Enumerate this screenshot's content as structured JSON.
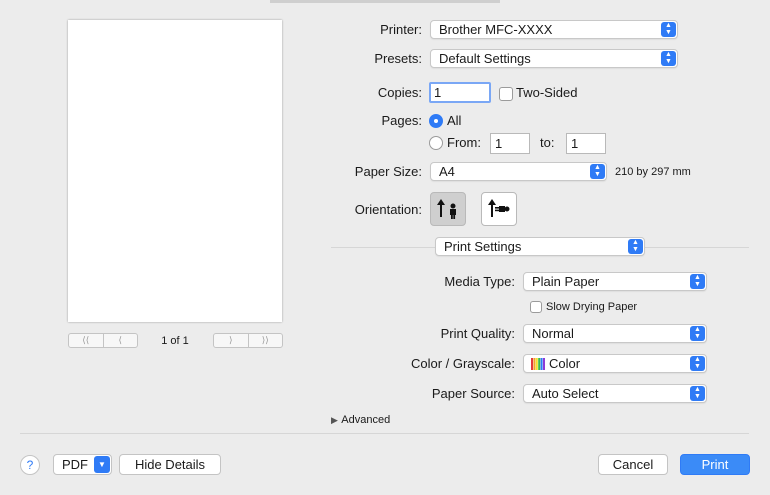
{
  "preview": {
    "page_label": "1 of 1"
  },
  "printer": {
    "label": "Printer:",
    "value": "Brother MFC-XXXX"
  },
  "presets": {
    "label": "Presets:",
    "value": "Default Settings"
  },
  "copies": {
    "label": "Copies:",
    "value": "1",
    "two_sided_label": "Two-Sided"
  },
  "pages": {
    "label": "Pages:",
    "all_label": "All",
    "from_label": "From:",
    "from_value": "1",
    "to_label": "to:",
    "to_value": "1"
  },
  "paper_size": {
    "label": "Paper Size:",
    "value": "A4",
    "dimensions": "210 by 297 mm"
  },
  "orientation": {
    "label": "Orientation:"
  },
  "section": {
    "value": "Print Settings"
  },
  "media_type": {
    "label": "Media Type:",
    "value": "Plain Paper",
    "slow_drying_label": "Slow Drying Paper"
  },
  "print_quality": {
    "label": "Print Quality:",
    "value": "Normal"
  },
  "color_grayscale": {
    "label": "Color / Grayscale:",
    "value": "Color"
  },
  "paper_source": {
    "label": "Paper Source:",
    "value": "Auto Select"
  },
  "advanced": {
    "label": "Advanced"
  },
  "footer": {
    "help_label": "?",
    "pdf_label": "PDF",
    "hide_details_label": "Hide Details",
    "cancel_label": "Cancel",
    "print_label": "Print"
  },
  "colors": {
    "accent": "#2f7bf6",
    "background": "#ececec"
  },
  "icons": {
    "popup_arrows": "chevron-updown-icon",
    "disclosure": "triangle-right-icon",
    "help": "question-icon"
  }
}
